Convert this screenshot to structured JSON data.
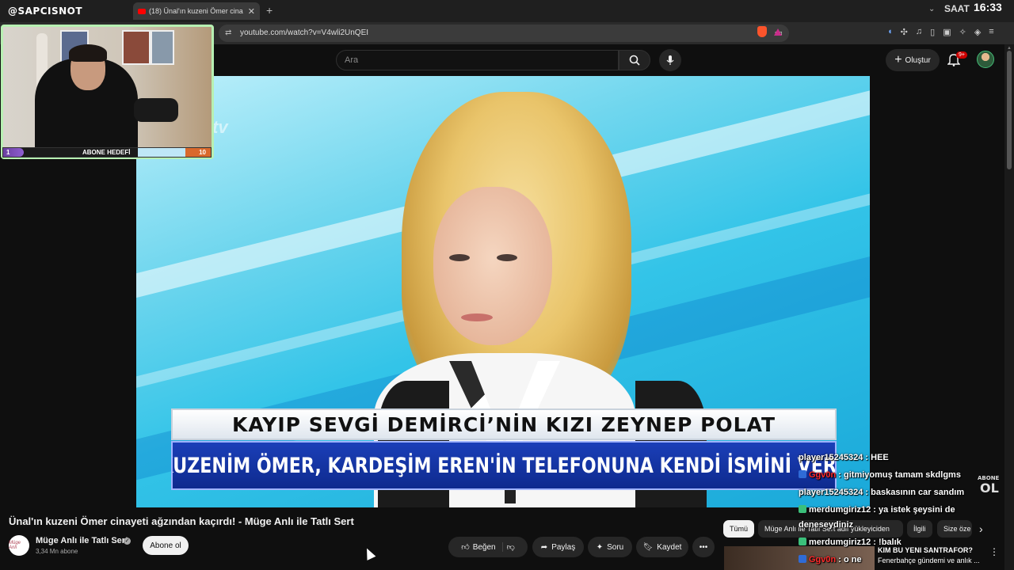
{
  "browser": {
    "brand": "@SAPCISNOT",
    "tab_title": "(18) Ünal'ın kuzeni Ömer cina",
    "new_tab": "+",
    "tab_close": "✕",
    "clock_label": "SAAT",
    "clock_time": "16:33",
    "url": "youtube.com/watch?v=V4wli2UnQEI"
  },
  "youtube": {
    "search_placeholder": "Ara",
    "create_label": "Oluştur",
    "notification_badge": "9+"
  },
  "video": {
    "banner_line1": "KAYIP SEVGİ DEMİRCİ’NİN KIZI ZEYNEP POLAT",
    "banner_line2": "\"KUZENİM ÖMER, KARDEŞİM EREN'İN TELEFONUNA KENDİ İSMİNİ VERDİ",
    "channel_logo_watermark": "tv",
    "title": "Ünal'ın kuzeni Ömer cinayeti ağzından kaçırdı! - Müge Anlı ile Tatlı Sert",
    "channel_name": "Müge Anlı ile Tatlı Sert",
    "channel_avatar_text": "Müge Anlı",
    "subscribers": "3,34 Mn abone",
    "subscribe_label": "Abone ol",
    "like_label": "Beğen",
    "share_label": "Paylaş",
    "ask_label": "Soru",
    "save_label": "Kaydet"
  },
  "webcam": {
    "goal_start": "1",
    "goal_label": "ABONE HEDEFİ",
    "goal_end": "10",
    "goal_progress": 0.1
  },
  "chips": [
    {
      "label": "Tümü",
      "active": true
    },
    {
      "label": "Müge Anlı ile Tatlı Sert adlı yükleyiciden",
      "active": false
    },
    {
      "label": "İlgili",
      "active": false
    },
    {
      "label": "Size öze",
      "active": false
    }
  ],
  "recommendation": {
    "title": "KIM BU YENI SANTRAFOR?",
    "subtitle": "Fenerbahçe gündemi ve anlık ..."
  },
  "chat": [
    {
      "user": "player15245324",
      "message": " : HEE",
      "user_color": "#ffffff",
      "badge": false
    },
    {
      "user": "Ggv0n",
      "message": " : gitmiyomuş tamam skdlgms",
      "user_color": "#ff2a2a",
      "badge": true,
      "badge_color": "#2f6bd6"
    },
    {
      "user": "player15245324",
      "message": " : baskasının car sandım",
      "user_color": "#ffffff",
      "badge": false
    },
    {
      "user": "merdumgiriz12",
      "message": " : ya istek şeysini de",
      "user_color": "#ffffff",
      "badge": true,
      "badge_color": "#3bbf7a"
    },
    {
      "user": "",
      "message": "deneseydiniz",
      "user_color": "#ffffff",
      "badge": false
    },
    {
      "user": "merdumgiriz12",
      "message": " : !balık",
      "user_color": "#ffffff",
      "badge": true,
      "badge_color": "#3bbf7a"
    },
    {
      "user": "Ggv0n",
      "message": " : o ne",
      "user_color": "#ff2a2a",
      "badge": true,
      "badge_color": "#2f6bd6"
    }
  ],
  "overlay": {
    "abone_small": "ABONE",
    "abone_big": "OL"
  },
  "colors": {
    "youtube_red": "#ff0000",
    "webcam_border": "#b7f0b2",
    "banner_blue": "#1b3fb8"
  }
}
